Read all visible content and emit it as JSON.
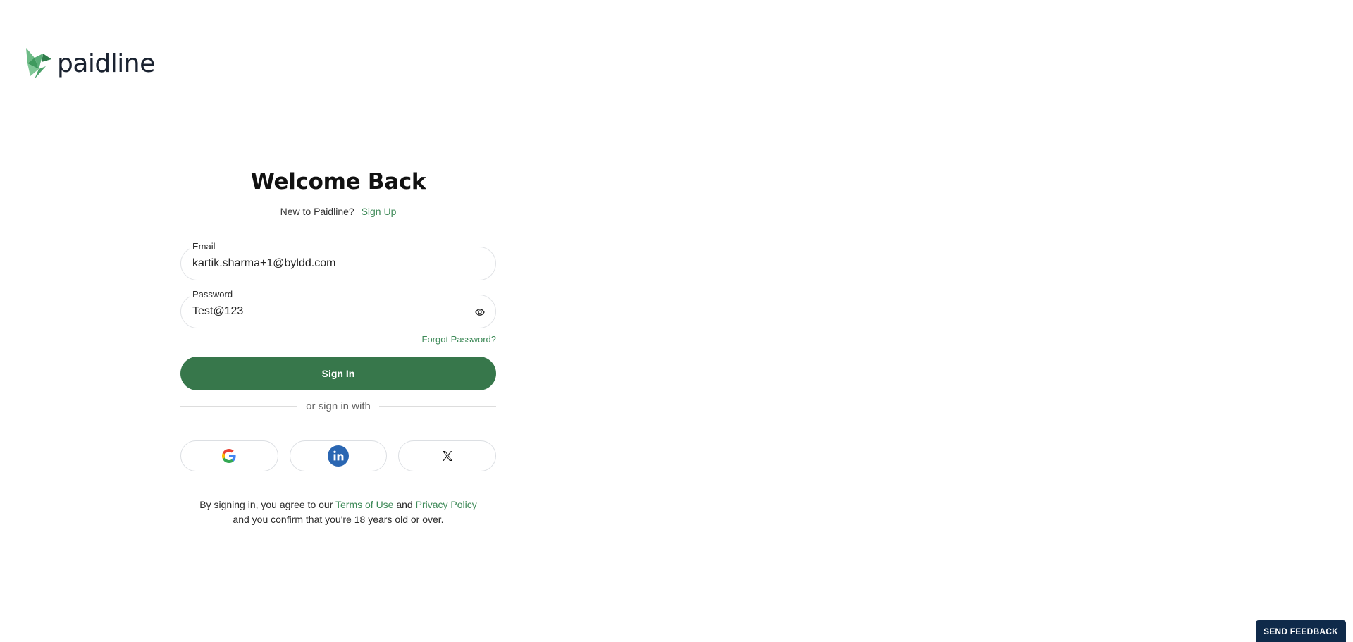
{
  "brand": {
    "name": "paidline",
    "logo_icon": "paidline-origami-bird-icon",
    "accent": "#37774b"
  },
  "form": {
    "title": "Welcome Back",
    "new_prompt": "New to Paidline?",
    "signup_link": "Sign Up",
    "email": {
      "label": "Email",
      "value": "kartik.sharma+1@byldd.com"
    },
    "password": {
      "label": "Password",
      "value": "Test@123",
      "toggle_icon": "eye-icon"
    },
    "forgot_link": "Forgot Password?",
    "signin_button": "Sign In",
    "divider_text": "or sign in with",
    "social": [
      {
        "name": "Google",
        "icon": "google-icon"
      },
      {
        "name": "LinkedIn",
        "icon": "linkedin-icon"
      },
      {
        "name": "X",
        "icon": "x-icon"
      }
    ],
    "terms": {
      "prefix": "By signing in, you agree to our",
      "terms_link": "Terms of Use",
      "and": "and",
      "privacy_link": "Privacy Policy",
      "suffix": "and you confirm that you're 18 years old or over."
    }
  },
  "feedback_button": "SEND FEEDBACK"
}
